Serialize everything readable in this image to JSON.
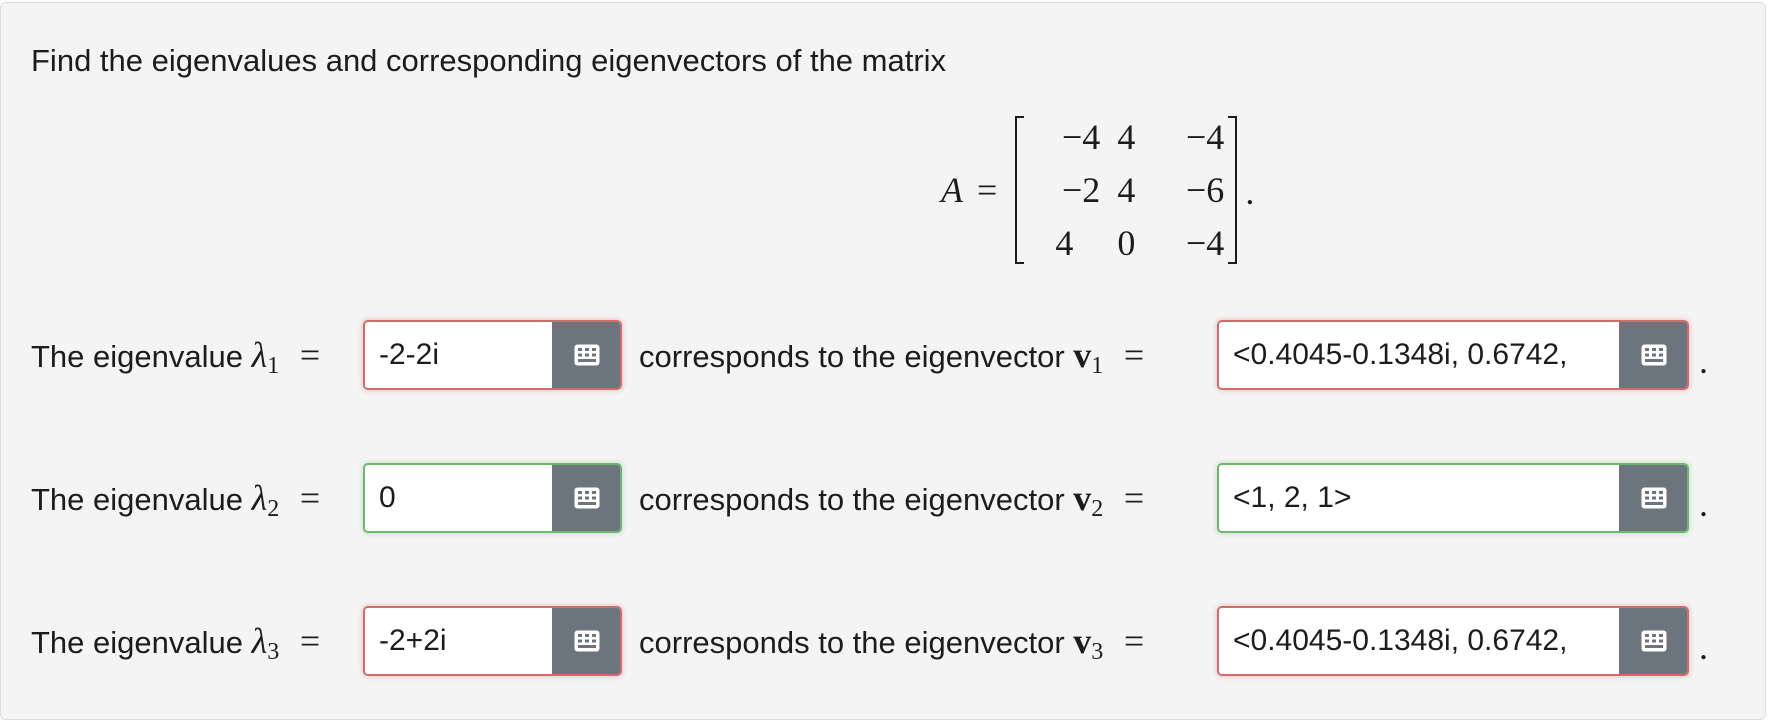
{
  "prompt": "Find the eigenvalues and corresponding eigenvectors of the matrix",
  "matrix": {
    "lhs": "A",
    "equals": "=",
    "rows": [
      [
        "−4",
        "4",
        "−4"
      ],
      [
        "−2",
        "4",
        "−6"
      ],
      [
        "4",
        "0",
        "−4"
      ]
    ],
    "trailing": "."
  },
  "rows": [
    {
      "eig_label": "The eigenvalue",
      "lambda": "λ",
      "sub": "1",
      "eq": "=",
      "eig_value": "-2-2i",
      "eig_status": "incorrect",
      "vec_label": "corresponds to the eigenvector",
      "vec_symbol": "v",
      "vec_sub": "1",
      "vec_eq": "=",
      "vec_value": "<0.4045-0.1348i, 0.6742, ",
      "vec_status": "incorrect",
      "trailing": "."
    },
    {
      "eig_label": "The eigenvalue",
      "lambda": "λ",
      "sub": "2",
      "eq": "=",
      "eig_value": "0",
      "eig_status": "correct",
      "vec_label": "corresponds to the eigenvector",
      "vec_symbol": "v",
      "vec_sub": "2",
      "vec_eq": "=",
      "vec_value": "<1, 2, 1>",
      "vec_status": "correct",
      "trailing": "."
    },
    {
      "eig_label": "The eigenvalue",
      "lambda": "λ",
      "sub": "3",
      "eq": "=",
      "eig_value": "-2+2i",
      "eig_status": "incorrect",
      "vec_label": "corresponds to the eigenvector",
      "vec_symbol": "v",
      "vec_sub": "3",
      "vec_eq": "=",
      "vec_value": "<0.4045-0.1348i, 0.6742, ",
      "vec_status": "incorrect",
      "trailing": "."
    }
  ],
  "icons": {
    "keyboard": "keyboard-grid-icon"
  },
  "colors": {
    "incorrect_border": "#d36b6b",
    "correct_border": "#6db66d",
    "button_bg": "#6c757d",
    "panel_bg": "#f4f4f4"
  }
}
